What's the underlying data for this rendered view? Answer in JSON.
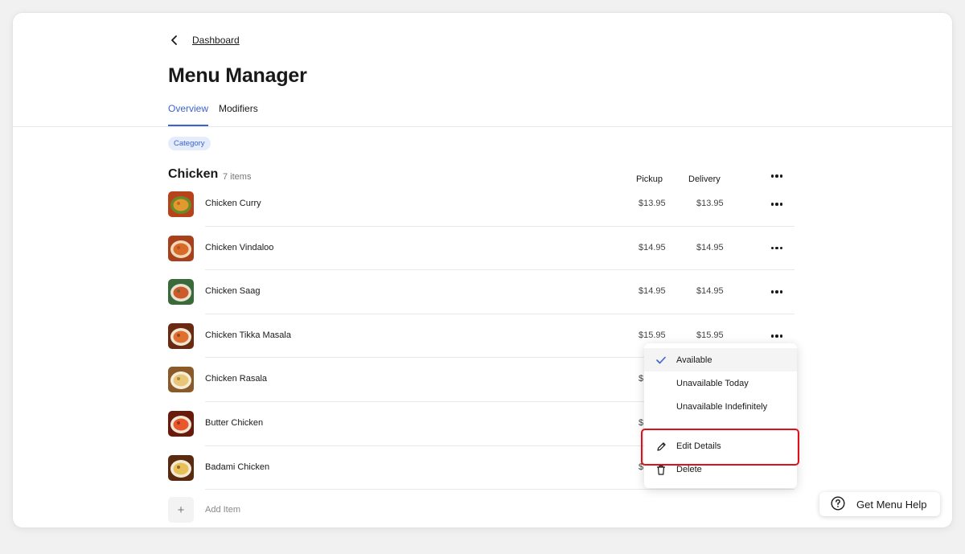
{
  "breadcrumb": {
    "back_label": "Dashboard"
  },
  "page": {
    "title": "Menu Manager"
  },
  "tabs": [
    {
      "label": "Overview",
      "active": true
    },
    {
      "label": "Modifiers",
      "active": false
    }
  ],
  "category": {
    "badge": "Category",
    "name": "Chicken",
    "count": "7 items",
    "columns": {
      "pickup": "Pickup",
      "delivery": "Delivery"
    }
  },
  "items": [
    {
      "name": "Chicken Curry",
      "pickup": "$13.95",
      "delivery": "$13.95",
      "thumb": [
        "#b8431a",
        "#e09a2e",
        "#6a8a2a"
      ]
    },
    {
      "name": "Chicken Vindaloo",
      "pickup": "$14.95",
      "delivery": "$14.95",
      "thumb": [
        "#a8401c",
        "#d86a2a",
        "#f0d8b8"
      ]
    },
    {
      "name": "Chicken Saag",
      "pickup": "$14.95",
      "delivery": "$14.95",
      "thumb": [
        "#3a6a3a",
        "#cc5a2a",
        "#e8e2d0"
      ]
    },
    {
      "name": "Chicken Tikka Masala",
      "pickup": "$15.95",
      "delivery": "$15.95",
      "thumb": [
        "#6a2a12",
        "#e07030",
        "#f2e6d0"
      ]
    },
    {
      "name": "Chicken Rasala",
      "pickup": "$",
      "delivery": "",
      "thumb": [
        "#8a5a2a",
        "#e8c878",
        "#f6eed8"
      ]
    },
    {
      "name": "Butter Chicken",
      "pickup": "$",
      "delivery": "",
      "thumb": [
        "#6a1a0a",
        "#e8582a",
        "#f0e6d6"
      ]
    },
    {
      "name": "Badami Chicken",
      "pickup": "$",
      "delivery": "",
      "thumb": [
        "#5a2a10",
        "#e8c058",
        "#f4ead4"
      ]
    }
  ],
  "add_item_label": "Add Item",
  "context_menu": {
    "items": [
      {
        "label": "Available",
        "icon": "checkmark-icon",
        "selected": true
      },
      {
        "label": "Unavailable Today",
        "icon": "",
        "selected": false
      },
      {
        "label": "Unavailable Indefinitely",
        "icon": "",
        "selected": false
      },
      {
        "label": "Edit Details",
        "icon": "pencil-icon",
        "selected": false
      },
      {
        "label": "Delete",
        "icon": "trash-icon",
        "selected": false
      }
    ]
  },
  "help_button": {
    "label": "Get Menu Help"
  },
  "colors": {
    "accent": "#3b63d1",
    "highlight": "#e0101b",
    "pill_bg": "#e5ecfb"
  }
}
